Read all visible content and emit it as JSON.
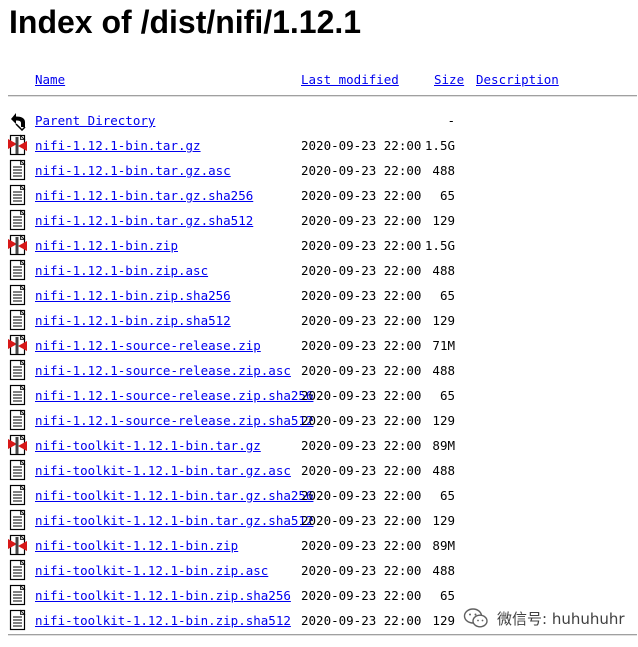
{
  "page": {
    "title": "Index of /dist/nifi/1.12.1"
  },
  "columns": {
    "name": "Name",
    "last_modified": "Last modified",
    "size": "Size",
    "description": "Description"
  },
  "parent": {
    "label": "Parent Directory",
    "size": "-",
    "icon": "back-arrow-icon"
  },
  "files": [
    {
      "name": "nifi-1.12.1-bin.tar.gz",
      "date": "2020-09-23 22:00",
      "size": "1.5G",
      "icon": "archive-icon"
    },
    {
      "name": "nifi-1.12.1-bin.tar.gz.asc",
      "date": "2020-09-23 22:00",
      "size": "488",
      "icon": "text-file-icon"
    },
    {
      "name": "nifi-1.12.1-bin.tar.gz.sha256",
      "date": "2020-09-23 22:00",
      "size": "65",
      "icon": "text-file-icon"
    },
    {
      "name": "nifi-1.12.1-bin.tar.gz.sha512",
      "date": "2020-09-23 22:00",
      "size": "129",
      "icon": "text-file-icon"
    },
    {
      "name": "nifi-1.12.1-bin.zip",
      "date": "2020-09-23 22:00",
      "size": "1.5G",
      "icon": "archive-icon"
    },
    {
      "name": "nifi-1.12.1-bin.zip.asc",
      "date": "2020-09-23 22:00",
      "size": "488",
      "icon": "text-file-icon"
    },
    {
      "name": "nifi-1.12.1-bin.zip.sha256",
      "date": "2020-09-23 22:00",
      "size": "65",
      "icon": "text-file-icon"
    },
    {
      "name": "nifi-1.12.1-bin.zip.sha512",
      "date": "2020-09-23 22:00",
      "size": "129",
      "icon": "text-file-icon"
    },
    {
      "name": "nifi-1.12.1-source-release.zip",
      "date": "2020-09-23 22:00",
      "size": "71M",
      "icon": "archive-icon"
    },
    {
      "name": "nifi-1.12.1-source-release.zip.asc",
      "date": "2020-09-23 22:00",
      "size": "488",
      "icon": "text-file-icon"
    },
    {
      "name": "nifi-1.12.1-source-release.zip.sha256",
      "date": "2020-09-23 22:00",
      "size": "65",
      "icon": "text-file-icon"
    },
    {
      "name": "nifi-1.12.1-source-release.zip.sha512",
      "date": "2020-09-23 22:00",
      "size": "129",
      "icon": "text-file-icon"
    },
    {
      "name": "nifi-toolkit-1.12.1-bin.tar.gz",
      "date": "2020-09-23 22:00",
      "size": "89M",
      "icon": "archive-icon"
    },
    {
      "name": "nifi-toolkit-1.12.1-bin.tar.gz.asc",
      "date": "2020-09-23 22:00",
      "size": "488",
      "icon": "text-file-icon"
    },
    {
      "name": "nifi-toolkit-1.12.1-bin.tar.gz.sha256",
      "date": "2020-09-23 22:00",
      "size": "65",
      "icon": "text-file-icon"
    },
    {
      "name": "nifi-toolkit-1.12.1-bin.tar.gz.sha512",
      "date": "2020-09-23 22:00",
      "size": "129",
      "icon": "text-file-icon"
    },
    {
      "name": "nifi-toolkit-1.12.1-bin.zip",
      "date": "2020-09-23 22:00",
      "size": "89M",
      "icon": "archive-icon"
    },
    {
      "name": "nifi-toolkit-1.12.1-bin.zip.asc",
      "date": "2020-09-23 22:00",
      "size": "488",
      "icon": "text-file-icon"
    },
    {
      "name": "nifi-toolkit-1.12.1-bin.zip.sha256",
      "date": "2020-09-23 22:00",
      "size": "65",
      "icon": "text-file-icon"
    },
    {
      "name": "nifi-toolkit-1.12.1-bin.zip.sha512",
      "date": "2020-09-23 22:00",
      "size": "129",
      "icon": "text-file-icon"
    }
  ],
  "watermark": {
    "text": "微信号: huhuhuhr",
    "icon": "wechat-icon"
  },
  "colors": {
    "link": "#0000ee",
    "archive_red": "#d81818"
  }
}
